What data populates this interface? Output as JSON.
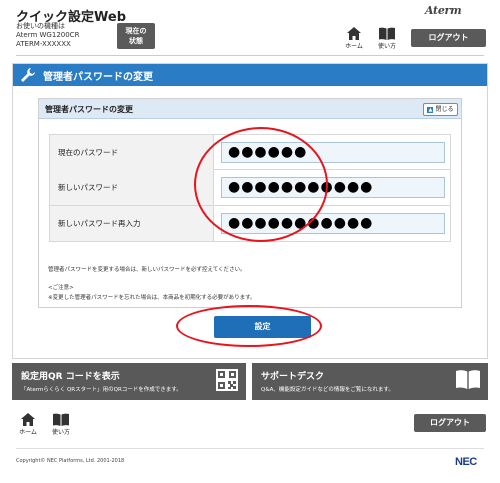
{
  "header": {
    "title": "クイック設定Web",
    "model_lines": [
      "お使いの機種は",
      "Aterm WG1200CR",
      "ATERM-XXXXXX"
    ],
    "status_button": [
      "現在の",
      "状態"
    ],
    "brand": "Aterm",
    "home_label": "ホーム",
    "manual_label": "使い方",
    "logout_label": "ログアウト"
  },
  "page": {
    "section_title": "管理者パスワードの変更",
    "subsection_title": "管理者パスワードの変更",
    "close_label": "閉じる"
  },
  "form": {
    "rows": [
      {
        "label": "現在のパスワード",
        "value": "●●●●●●"
      },
      {
        "label": "新しいパスワード",
        "value": "●●●●●●●●●●●"
      },
      {
        "label": "新しいパスワード再入力",
        "value": "●●●●●●●●●●●"
      }
    ]
  },
  "notes": {
    "line1": "管理者パスワードを変更する場合は、新しいパスワードを必ず控えてください。",
    "line2": "<ご注意>",
    "line3": "※変更した管理者パスワードを忘れた場合は、本商品を初期化する必要があります。"
  },
  "submit_label": "設定",
  "cards": {
    "qr": {
      "title": "設定用QR コードを表示",
      "desc": "「Atermらくらく QRスタート」用のQRコードを作成できます。",
      "icon": "qr-code-icon"
    },
    "support": {
      "title": "サポートデスク",
      "desc": "Q&A、機能設定ガイドなどの情報をご覧になれます。",
      "icon": "book-icon"
    }
  },
  "footer": {
    "home_label": "ホーム",
    "manual_label": "使い方",
    "logout_label": "ログアウト",
    "copyright": "Copyright© NEC Platforms, Ltd. 2001-2018",
    "logo": "NEC"
  },
  "colors": {
    "accent_blue": "#2a7cc4",
    "button_blue": "#1e6eb8",
    "dark_gray": "#595959",
    "annotation_red": "#e8141c"
  }
}
